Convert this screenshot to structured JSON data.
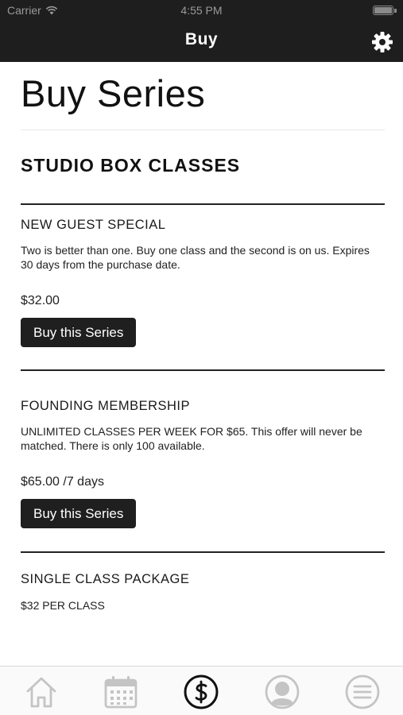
{
  "status_bar": {
    "carrier": "Carrier",
    "time": "4:55 PM"
  },
  "nav": {
    "title": "Buy",
    "settings_icon": "gear-icon"
  },
  "page": {
    "title": "Buy Series",
    "section_title": "STUDIO BOX CLASSES"
  },
  "series": [
    {
      "name": "NEW GUEST SPECIAL",
      "description": "Two is better than one. Buy one class and the second is on us. Expires 30 days from the purchase date.",
      "price": "$32.00",
      "button_label": "Buy this Series"
    },
    {
      "name": "FOUNDING MEMBERSHIP",
      "description": "UNLIMITED CLASSES PER WEEK FOR $65. This offer will never be matched. There is only 100 available.",
      "price": "$65.00 /7 days",
      "button_label": "Buy this Series"
    },
    {
      "name": "SINGLE CLASS PACKAGE",
      "description": "$32 PER CLASS"
    }
  ],
  "tabbar": {
    "tabs": [
      {
        "icon": "home-icon",
        "active": false
      },
      {
        "icon": "calendar-icon",
        "active": false
      },
      {
        "icon": "dollar-icon",
        "active": true
      },
      {
        "icon": "profile-icon",
        "active": false
      },
      {
        "icon": "menu-icon",
        "active": false
      }
    ]
  },
  "colors": {
    "nav_bg": "#1e1e1e",
    "button_bg": "#1f1f1f",
    "inactive_tab": "#c4c4c4",
    "active_tab": "#111111"
  }
}
